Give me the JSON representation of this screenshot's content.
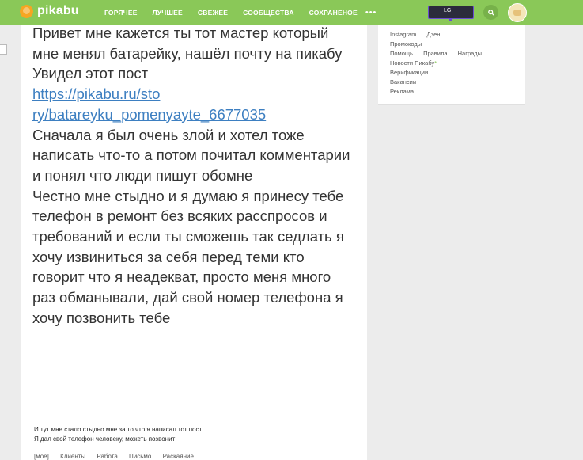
{
  "brand": {
    "name": "pikabu",
    "accent": "#8ac858",
    "logo_color": "#f5a623"
  },
  "nav": {
    "items": [
      "ГОРЯЧЕЕ",
      "ЛУЧШЕЕ",
      "СВЕЖЕЕ",
      "СООБЩЕСТВА",
      "СОХРАНЕНОЕ"
    ],
    "more": "•••"
  },
  "ad_badge": {
    "label": "LG"
  },
  "icons": {
    "search": "search-icon",
    "avatar": "user-avatar"
  },
  "post": {
    "paragraphs": [
      "Привет мне кажется ты тот мастер который мне менял батарейку, нашёл почту на пикабу",
      "Увидел этот пост"
    ],
    "link_line1": "https://pikabu.ru/sto",
    "link_line2": "ry/batareyku_pomenyayte_6677035",
    "paragraphs_after": [
      "Сначала я был очень злой и хотел тоже написать что-то а потом почитал комментарии и понял что люди пишут обомне",
      "Честно мне стыдно и я думаю я принесу тебе телефон в ремонт без всяких расспросов и требований и если ты сможешь так седлать я хочу извиниться за себя перед теми кто говорит что я неадекват, просто меня много раз обманывали, дай свой номер телефона я хочу позвонить тебе"
    ],
    "note_line1": "И тут мне стало  стыдно мне за то что я написал тот пост.",
    "note_line2": "Я дал свой телефон человеку, можеть позвонит",
    "tags": [
      "[моё]",
      "Клиенты",
      "Работа",
      "Письмо",
      "Раскаяние"
    ]
  },
  "sidebar": {
    "row1": [
      "Instagram",
      "Дзен"
    ],
    "row2": [
      "Промокоды"
    ],
    "row3": [
      "Помощь",
      "Правила",
      "Награды"
    ],
    "row4": "Новости Пикабу",
    "row4_mark": "*",
    "row5": "Верификации",
    "row6": "Вакансии",
    "row7": "Реклама"
  }
}
